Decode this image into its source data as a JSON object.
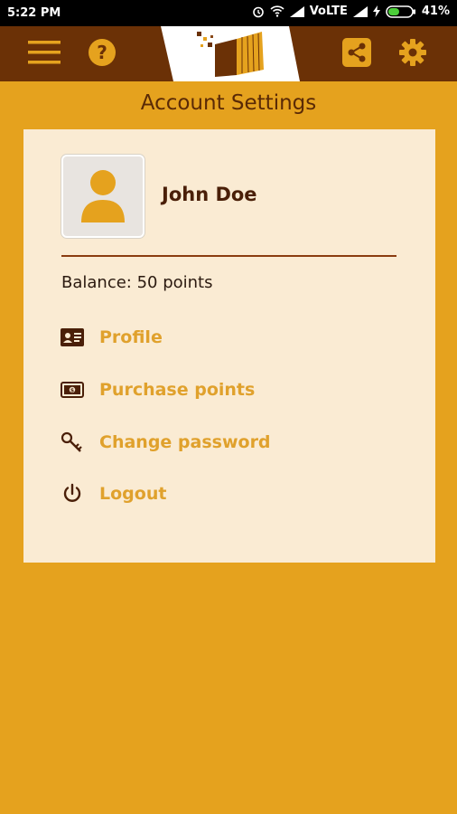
{
  "status_bar": {
    "time": "5:22 PM",
    "network": "VoLTE",
    "battery": "41%"
  },
  "app_bar": {
    "icons": [
      "menu-icon",
      "help-icon",
      "app-logo",
      "share-icon",
      "settings-icon"
    ]
  },
  "page": {
    "title": "Account Settings"
  },
  "account": {
    "name": "John Doe",
    "balance": "Balance: 50 points"
  },
  "menu": {
    "items": [
      {
        "label": "Profile",
        "icon": "id-card-icon"
      },
      {
        "label": "Purchase points",
        "icon": "banknote-icon"
      },
      {
        "label": "Change password",
        "icon": "key-icon"
      },
      {
        "label": "Logout",
        "icon": "power-icon"
      }
    ]
  },
  "colors": {
    "background": "#e5a21e",
    "app_bar": "#6b3106",
    "card": "#faebd3",
    "accent_text": "#e0a12c",
    "dark_text": "#4a1f08"
  }
}
